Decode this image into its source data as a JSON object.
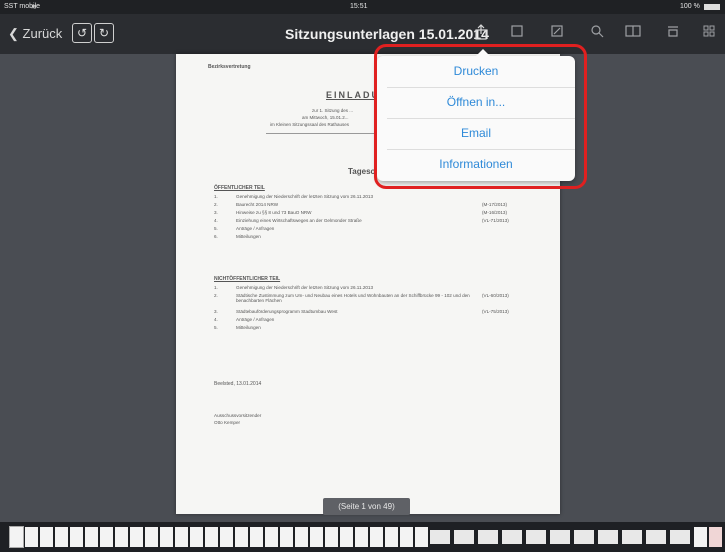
{
  "status": {
    "carrier": "SST mobile",
    "time": "15:51",
    "battery": "100 %"
  },
  "navbar": {
    "back_label": "Zurück",
    "undo_symbol": "↺",
    "redo_symbol": "↻",
    "title": "Sitzungsunterlagen 15.01.2014"
  },
  "document": {
    "header_small": "Bezirksvertretung",
    "heading": "EINLADUNG",
    "sublines": [
      "zur 1. Sitzung des ...",
      "am Mittwoch, 15.01.2...",
      "im Kleinen Sitzungssaal des Rathauses"
    ],
    "agenda_title": "Tagesordnung",
    "section_public": "ÖFFENTLICHER TEIL",
    "public_items": [
      {
        "n": "1.",
        "text": "Genehmigung der Niederschrift der letzten Sitzung vom 26.11.2013",
        "ref": ""
      },
      {
        "n": "2.",
        "text": "Baurecht 2014 NRW",
        "ref": "(M-17/2013)"
      },
      {
        "n": "3.",
        "text": "Hinweise zu §§ 8 und 73 BauO NRW",
        "ref": "(M-16/2013)"
      },
      {
        "n": "4.",
        "text": "Einziehung eines Wirtschaftsweges an der Gelmonder Straße",
        "ref": "(VL-71/2013)"
      },
      {
        "n": "5.",
        "text": "Anträge / Anfragen",
        "ref": ""
      },
      {
        "n": "6.",
        "text": "Mitteilungen",
        "ref": ""
      }
    ],
    "section_nonpublic": "NICHTÖFFENTLICHER TEIL",
    "nonpublic_items": [
      {
        "n": "1.",
        "text": "Genehmigung der Niederschrift der letzten Sitzung vom 26.11.2013",
        "ref": ""
      },
      {
        "n": "2.",
        "text": "Städtische Zustimmung zum Um- und Neubau eines Hotels und Wohnbauten an der Schiffbrücke 99 - 102 und den benachbarten Flächen",
        "ref": "(VL-60/2013)"
      },
      {
        "n": "3.",
        "text": "Städtebauförderungsprogramm Stadtumbau West",
        "ref": "(VL-75/2013)"
      },
      {
        "n": "4.",
        "text": "Anträge / Anfragen",
        "ref": ""
      },
      {
        "n": "5.",
        "text": "Mitteilungen",
        "ref": ""
      }
    ],
    "place_date": "Beelsted, 13.01.2014",
    "signature_lines": [
      "Ausschussvorsitzender",
      "Otto Kemper"
    ]
  },
  "page_indicator": "(Seite 1 von 49)",
  "share_menu": {
    "items": [
      "Drucken",
      "Öffnen in...",
      "Email",
      "Informationen"
    ]
  },
  "colors": {
    "accent": "#2f8ad8",
    "highlight": "#e02020",
    "navbar": "#2b2d31",
    "background": "#4a4d53"
  },
  "icons": [
    "share-icon",
    "bookmark-icon",
    "annotate-icon",
    "search-icon",
    "book-icon",
    "toolbox-icon",
    "grid-icon"
  ]
}
